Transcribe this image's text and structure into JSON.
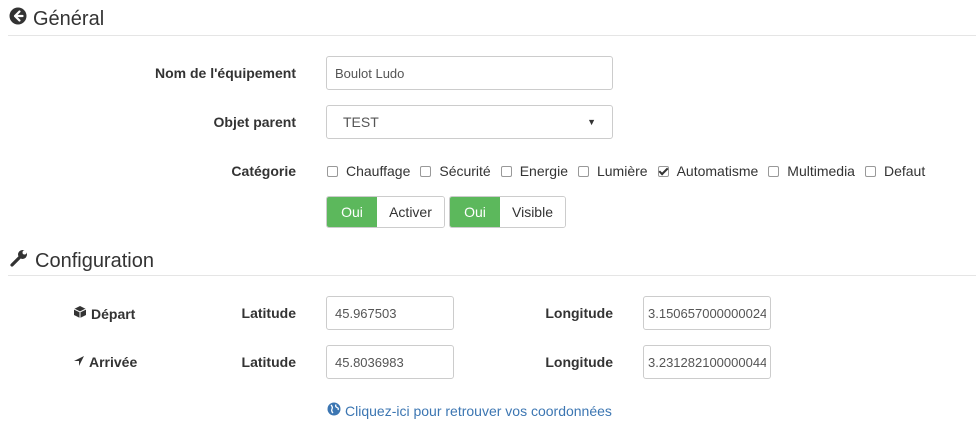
{
  "general": {
    "title": "Général",
    "icon": "arrow-circle-left-icon",
    "name_label": "Nom de l'équipement",
    "name_value": "Boulot Ludo",
    "parent_label": "Objet parent",
    "parent_value": "TEST",
    "category_label": "Catégorie",
    "categories": [
      {
        "label": "Chauffage",
        "checked": false
      },
      {
        "label": "Sécurité",
        "checked": false
      },
      {
        "label": "Energie",
        "checked": false
      },
      {
        "label": "Lumière",
        "checked": false
      },
      {
        "label": "Automatisme",
        "checked": true
      },
      {
        "label": "Multimedia",
        "checked": false
      },
      {
        "label": "Defaut",
        "checked": false
      }
    ],
    "toggle_active": {
      "on_label": "Oui",
      "label": "Activer"
    },
    "toggle_visible": {
      "on_label": "Oui",
      "label": "Visible"
    }
  },
  "configuration": {
    "title": "Configuration",
    "icon": "wrench-icon",
    "depart": {
      "label": "Départ",
      "icon": "cube-icon",
      "lat_label": "Latitude",
      "lat_value": "45.967503",
      "lon_label": "Longitude",
      "lon_value": "3.150657000000024"
    },
    "arrivee": {
      "label": "Arrivée",
      "icon": "location-arrow-icon",
      "lat_label": "Latitude",
      "lat_value": "45.8036983",
      "lon_label": "Longitude",
      "lon_value": "3.231282100000044"
    },
    "help_link": "Cliquez-ici pour retrouver vos coordonnées",
    "help_icon": "globe-icon"
  },
  "colors": {
    "accent_green": "#5cb85c",
    "link_blue": "#3c76b2"
  }
}
